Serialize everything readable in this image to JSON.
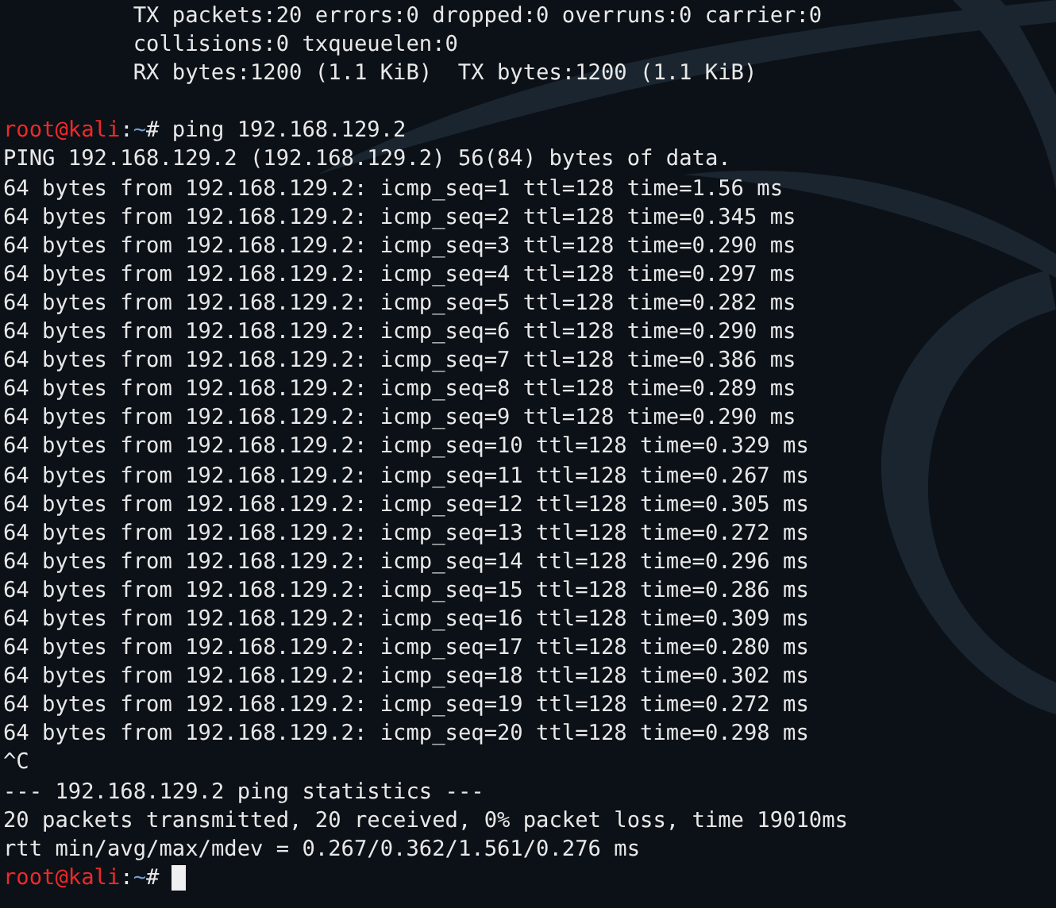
{
  "terminal": {
    "lines": [
      {
        "kind": "detail",
        "text": "TX packets:20 errors:0 dropped:0 overruns:0 carrier:0"
      },
      {
        "kind": "detail",
        "text": "collisions:0 txqueuelen:0"
      },
      {
        "kind": "detail",
        "text": "RX bytes:1200 (1.1 KiB)  TX bytes:1200 (1.1 KiB)"
      },
      {
        "kind": "blank"
      },
      {
        "kind": "prompt",
        "user": "root@kali",
        "separator": ":",
        "path": "~",
        "symbol": "#",
        "command": "ping 192.168.129.2",
        "cursor": false
      },
      {
        "kind": "output",
        "text": "PING 192.168.129.2 (192.168.129.2) 56(84) bytes of data."
      },
      {
        "kind": "output",
        "text": "64 bytes from 192.168.129.2: icmp_seq=1 ttl=128 time=1.56 ms"
      },
      {
        "kind": "output",
        "text": "64 bytes from 192.168.129.2: icmp_seq=2 ttl=128 time=0.345 ms"
      },
      {
        "kind": "output",
        "text": "64 bytes from 192.168.129.2: icmp_seq=3 ttl=128 time=0.290 ms"
      },
      {
        "kind": "output",
        "text": "64 bytes from 192.168.129.2: icmp_seq=4 ttl=128 time=0.297 ms"
      },
      {
        "kind": "output",
        "text": "64 bytes from 192.168.129.2: icmp_seq=5 ttl=128 time=0.282 ms"
      },
      {
        "kind": "output",
        "text": "64 bytes from 192.168.129.2: icmp_seq=6 ttl=128 time=0.290 ms"
      },
      {
        "kind": "output",
        "text": "64 bytes from 192.168.129.2: icmp_seq=7 ttl=128 time=0.386 ms"
      },
      {
        "kind": "output",
        "text": "64 bytes from 192.168.129.2: icmp_seq=8 ttl=128 time=0.289 ms"
      },
      {
        "kind": "output",
        "text": "64 bytes from 192.168.129.2: icmp_seq=9 ttl=128 time=0.290 ms"
      },
      {
        "kind": "output",
        "text": "64 bytes from 192.168.129.2: icmp_seq=10 ttl=128 time=0.329 ms"
      },
      {
        "kind": "output",
        "text": "64 bytes from 192.168.129.2: icmp_seq=11 ttl=128 time=0.267 ms"
      },
      {
        "kind": "output",
        "text": "64 bytes from 192.168.129.2: icmp_seq=12 ttl=128 time=0.305 ms"
      },
      {
        "kind": "output",
        "text": "64 bytes from 192.168.129.2: icmp_seq=13 ttl=128 time=0.272 ms"
      },
      {
        "kind": "output",
        "text": "64 bytes from 192.168.129.2: icmp_seq=14 ttl=128 time=0.296 ms"
      },
      {
        "kind": "output",
        "text": "64 bytes from 192.168.129.2: icmp_seq=15 ttl=128 time=0.286 ms"
      },
      {
        "kind": "output",
        "text": "64 bytes from 192.168.129.2: icmp_seq=16 ttl=128 time=0.309 ms"
      },
      {
        "kind": "output",
        "text": "64 bytes from 192.168.129.2: icmp_seq=17 ttl=128 time=0.280 ms"
      },
      {
        "kind": "output",
        "text": "64 bytes from 192.168.129.2: icmp_seq=18 ttl=128 time=0.302 ms"
      },
      {
        "kind": "output",
        "text": "64 bytes from 192.168.129.2: icmp_seq=19 ttl=128 time=0.272 ms"
      },
      {
        "kind": "output",
        "text": "64 bytes from 192.168.129.2: icmp_seq=20 ttl=128 time=0.298 ms"
      },
      {
        "kind": "output",
        "text": "^C"
      },
      {
        "kind": "output",
        "text": "--- 192.168.129.2 ping statistics ---"
      },
      {
        "kind": "output",
        "text": "20 packets transmitted, 20 received, 0% packet loss, time 19010ms"
      },
      {
        "kind": "output",
        "text": "rtt min/avg/max/mdev = 0.267/0.362/1.561/0.276 ms"
      },
      {
        "kind": "prompt",
        "user": "root@kali",
        "separator": ":",
        "path": "~",
        "symbol": "#",
        "cursor": true
      }
    ]
  }
}
